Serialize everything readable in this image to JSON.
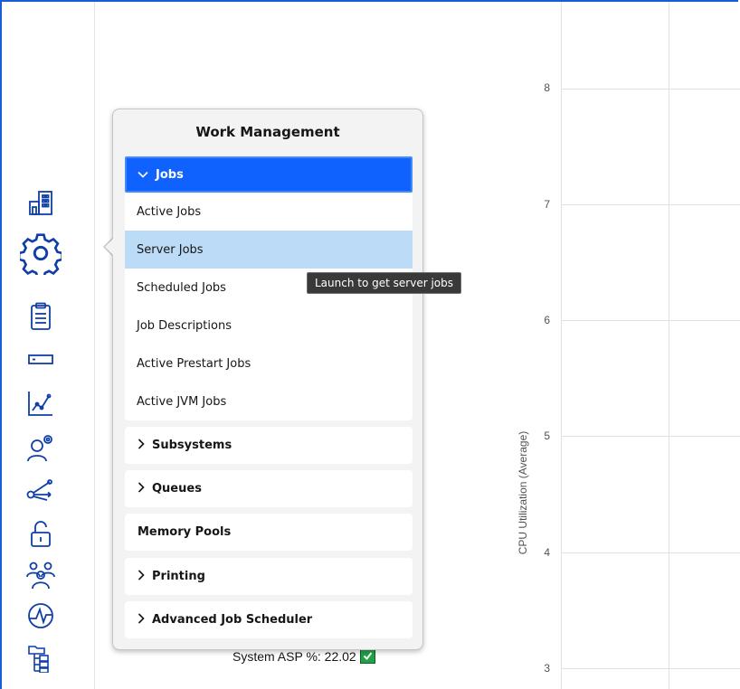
{
  "popover": {
    "title": "Work Management",
    "jobs": {
      "header": "Jobs",
      "items": [
        "Active Jobs",
        "Server Jobs",
        "Scheduled Jobs",
        "Job Descriptions",
        "Active Prestart Jobs",
        "Active JVM Jobs"
      ],
      "selected": "Server Jobs"
    },
    "sections": [
      "Subsystems",
      "Queues",
      "Memory Pools",
      "Printing",
      "Advanced Job Scheduler"
    ]
  },
  "tooltip": {
    "text": "Launch to get server jobs"
  },
  "status": {
    "asp_text": "System ASP %: 22.02"
  },
  "chart_data": {
    "type": "line",
    "ylabel": "CPU Utilization (Average)",
    "yticks": [
      "8",
      "7",
      "6",
      "5",
      "4",
      "3"
    ],
    "series": []
  },
  "sidebar": {
    "icons": [
      "building-icon",
      "gear-icon",
      "clipboard-icon",
      "server-icon",
      "line-chart-icon",
      "user-settings-icon",
      "network-icon",
      "unlock-icon",
      "user-group-icon",
      "performance-icon",
      "tree-view-icon"
    ]
  },
  "colors": {
    "accent": "#0f62fe",
    "selected": "#bcdbf7",
    "check": "#24a148"
  }
}
